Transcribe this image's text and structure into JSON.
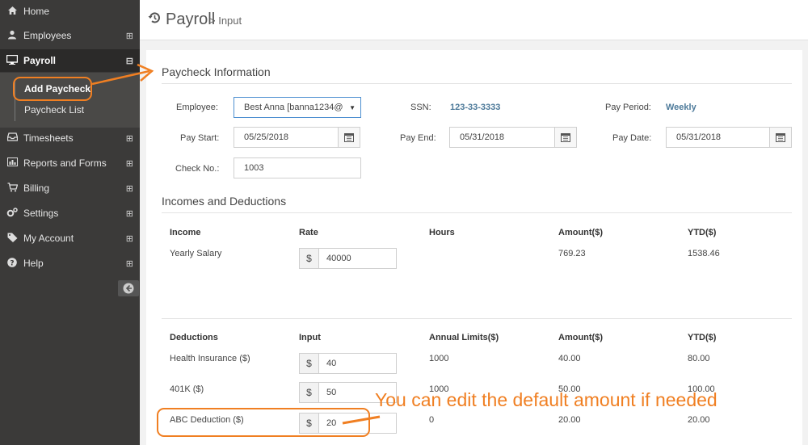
{
  "sidebar": {
    "items": [
      {
        "label": "Home",
        "icon": "home-icon"
      },
      {
        "label": "Employees",
        "icon": "user-icon",
        "toggle": "⊞"
      },
      {
        "label": "Payroll",
        "icon": "monitor-icon",
        "toggle": "⊟"
      },
      {
        "label": "Timesheets",
        "icon": "inbox-icon",
        "toggle": "⊞"
      },
      {
        "label": "Reports and Forms",
        "icon": "bar-chart-icon",
        "toggle": "⊞"
      },
      {
        "label": "Billing",
        "icon": "cart-icon",
        "toggle": "⊞"
      },
      {
        "label": "Settings",
        "icon": "gears-icon",
        "toggle": "⊞"
      },
      {
        "label": "My Account",
        "icon": "tag-icon",
        "toggle": "⊞"
      },
      {
        "label": "Help",
        "icon": "question-icon",
        "toggle": "⊞"
      }
    ],
    "submenu": [
      {
        "label": "Add Paycheck"
      },
      {
        "label": "Paycheck List"
      }
    ],
    "collapse_icon": "arrow-left-circle-icon"
  },
  "header": {
    "title": "Payroll",
    "breadcrumb": "> Input"
  },
  "paycheck": {
    "section_title": "Paycheck Information",
    "employee_label": "Employee:",
    "employee_value": "Best Anna [banna1234@",
    "ssn_label": "SSN:",
    "ssn_value": "123-33-3333",
    "pay_period_label": "Pay Period:",
    "pay_period_value": "Weekly",
    "pay_start_label": "Pay Start:",
    "pay_start_value": "05/25/2018",
    "pay_end_label": "Pay End:",
    "pay_end_value": "05/31/2018",
    "pay_date_label": "Pay Date:",
    "pay_date_value": "05/31/2018",
    "check_no_label": "Check No.:",
    "check_no_value": "1003"
  },
  "incomes": {
    "section_title": "Incomes and Deductions",
    "income_headers": [
      "Income",
      "Rate",
      "Hours",
      "Amount($)",
      "YTD($)"
    ],
    "income_rows": [
      {
        "name": "Yearly Salary",
        "rate": "40000",
        "hours": "",
        "amount": "769.23",
        "ytd": "1538.46"
      }
    ],
    "deduction_headers": [
      "Deductions",
      "Input",
      "Annual Limits($)",
      "Amount($)",
      "YTD($)"
    ],
    "deduction_rows": [
      {
        "name": "Health Insurance ($)",
        "input": "40",
        "limit": "1000",
        "amount": "40.00",
        "ytd": "80.00"
      },
      {
        "name": "401K ($)",
        "input": "50",
        "limit": "1000",
        "amount": "50.00",
        "ytd": "100.00"
      },
      {
        "name": "ABC Deduction ($)",
        "input": "20",
        "limit": "0",
        "amount": "20.00",
        "ytd": "20.00"
      }
    ],
    "currency_symbol": "$"
  },
  "annotation": {
    "text": "You can edit the default amount if needed",
    "color": "#f07f22"
  }
}
